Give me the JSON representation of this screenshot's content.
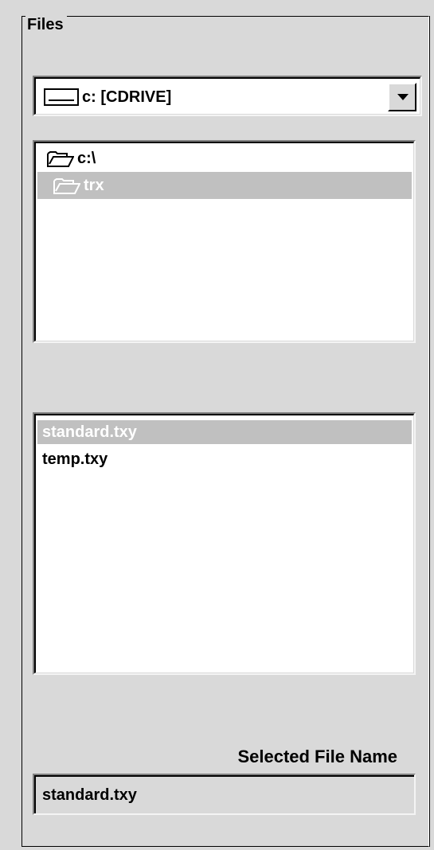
{
  "group": {
    "title": "Files"
  },
  "drive": {
    "selected": "c: [CDRIVE]",
    "icon": "drive-icon"
  },
  "directories": [
    {
      "label": "c:\\",
      "icon": "open-folder-icon",
      "selected": false
    },
    {
      "label": "trx",
      "icon": "open-folder-icon",
      "selected": true
    }
  ],
  "files": [
    {
      "label": "standard.txy",
      "selected": true
    },
    {
      "label": "temp.txy",
      "selected": false
    }
  ],
  "selected_file": {
    "label": "Selected File Name",
    "value": "standard.txy"
  },
  "colors": {
    "background": "#d9d9d9",
    "selection": "#c0c0c0",
    "selection_text": "#ffffff"
  }
}
